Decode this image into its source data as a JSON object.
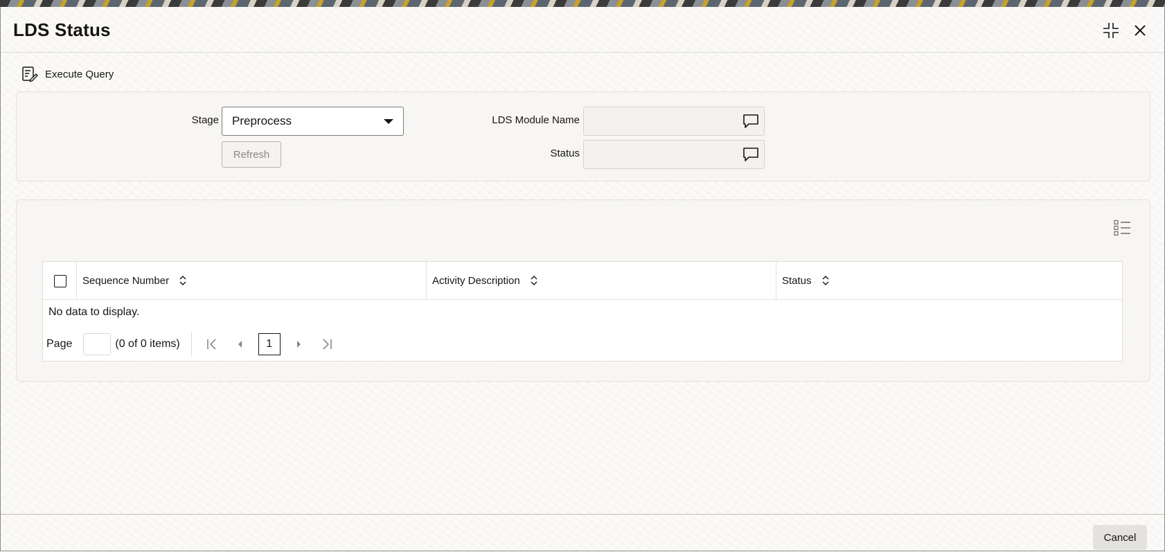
{
  "window": {
    "title": "LDS Status",
    "minimize_icon": "collapse-icon",
    "close_icon": "close-icon"
  },
  "toolbar": {
    "execute_query_label": "Execute Query",
    "execute_query_icon": "query-edit-icon"
  },
  "form": {
    "stage_label": "Stage",
    "stage_value": "Preprocess",
    "refresh_label": "Refresh",
    "module_name_label": "LDS Module Name",
    "module_name_value": "",
    "status_label": "Status",
    "status_value": ""
  },
  "grid": {
    "columns": [
      "Sequence Number",
      "Activity Description",
      "Status"
    ],
    "rows": [],
    "empty_text": "No data to display.",
    "page_label": "Page",
    "page_input_value": "",
    "items_summary": "(0 of 0 items)",
    "current_page": "1"
  },
  "footer": {
    "cancel_label": "Cancel"
  }
}
